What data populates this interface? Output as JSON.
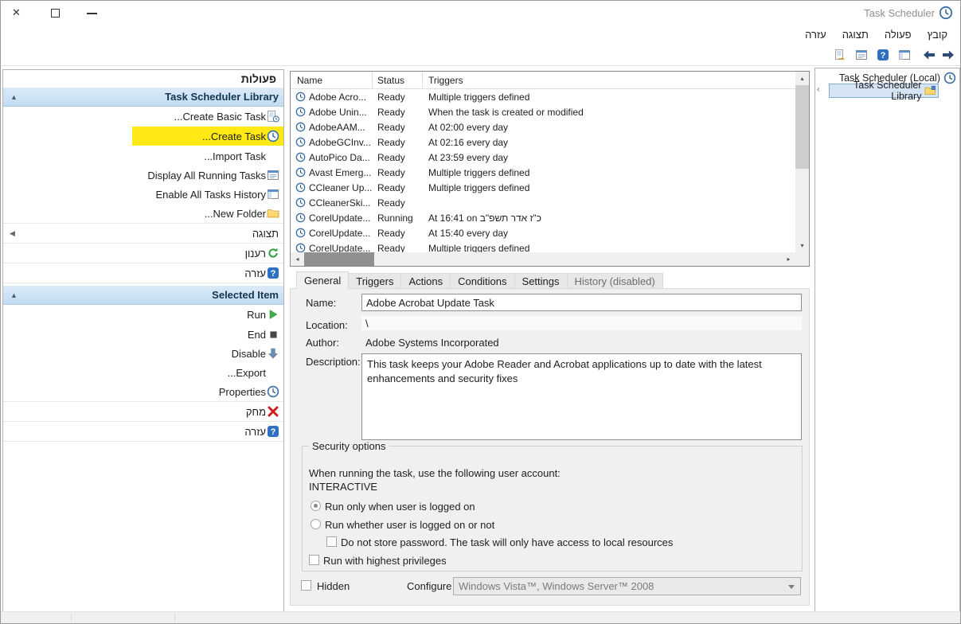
{
  "window": {
    "title": "Task Scheduler"
  },
  "menu": {
    "file": "קובץ",
    "action": "פעולה",
    "view": "תצוגה",
    "help": "עזרה"
  },
  "toolbar": {
    "icons": [
      "back-arrow",
      "forward-arrow",
      "show-console-tree",
      "help",
      "show-action-pane",
      "export-list"
    ]
  },
  "tree": {
    "root_label": "Task Scheduler (Local)",
    "selected_label": "Task Scheduler Library"
  },
  "task_list": {
    "columns": {
      "name": "Name",
      "status": "Status",
      "triggers": "Triggers"
    },
    "rows": [
      {
        "name": "Adobe Acro...",
        "status": "Ready",
        "triggers": "Multiple triggers defined"
      },
      {
        "name": "Adobe Unin...",
        "status": "Ready",
        "triggers": "When the task is created or modified"
      },
      {
        "name": "AdobeAAM...",
        "status": "Ready",
        "triggers": "At 02:00 every day"
      },
      {
        "name": "AdobeGCInv...",
        "status": "Ready",
        "triggers": "At 02:16 every day"
      },
      {
        "name": "AutoPico Da...",
        "status": "Ready",
        "triggers": "At 23:59 every day"
      },
      {
        "name": "Avast Emerg...",
        "status": "Ready",
        "triggers": "Multiple triggers defined"
      },
      {
        "name": "CCleaner Up...",
        "status": "Ready",
        "triggers": "Multiple triggers defined"
      },
      {
        "name": "CCleanerSki...",
        "status": "Ready",
        "triggers": ""
      },
      {
        "name": "CorelUpdate...",
        "status": "Running",
        "triggers": "At 16:41 on כ\"ז אדר תשפ\"ב"
      },
      {
        "name": "CorelUpdate...",
        "status": "Ready",
        "triggers": "At 15:40 every day"
      },
      {
        "name": "CorelUpdate...",
        "status": "Ready",
        "triggers": "Multiple triggers defined"
      }
    ]
  },
  "tabs": {
    "general": "General",
    "triggers": "Triggers",
    "actions": "Actions",
    "conditions": "Conditions",
    "settings": "Settings",
    "history": "History (disabled)"
  },
  "general_tab": {
    "name_label": "Name:",
    "name_value": "Adobe Acrobat Update Task",
    "location_label": "Location:",
    "location_value": "\\",
    "author_label": "Author:",
    "author_value": "Adobe Systems Incorporated",
    "description_label": "Description:",
    "description_value": "This task keeps your Adobe Reader and Acrobat applications up to date with the latest enhancements and security fixes",
    "security": {
      "group_title": "Security options",
      "account_text": "When running the task, use the following user account:",
      "account_value": "INTERACTIVE",
      "radio_logged_on": "Run only when user is logged on",
      "radio_logged_on_or_not": "Run whether user is logged on or not",
      "checkbox_no_password": "Do not store password.  The task will only have access to local resources",
      "checkbox_highest_privileges": "Run with highest privileges"
    },
    "hidden_label": "Hidden",
    "configure_label": "Configure for:",
    "configure_value": "Windows Vista™, Windows Server™ 2008"
  },
  "actions_pane": {
    "title": "פעולות",
    "library_header": "Task Scheduler Library",
    "library_items": [
      "Create Basic Task...",
      "Create Task...",
      "Import Task...",
      "Display All Running Tasks",
      "Enable All Tasks History",
      "New Folder..."
    ],
    "view_header": "תצוגה",
    "view_items": [
      "רענון",
      "עזרה"
    ],
    "selected_header": "Selected Item",
    "selected_items": [
      "Run",
      "End",
      "Disable",
      "Export...",
      "Properties",
      "מחק",
      "עזרה"
    ]
  }
}
